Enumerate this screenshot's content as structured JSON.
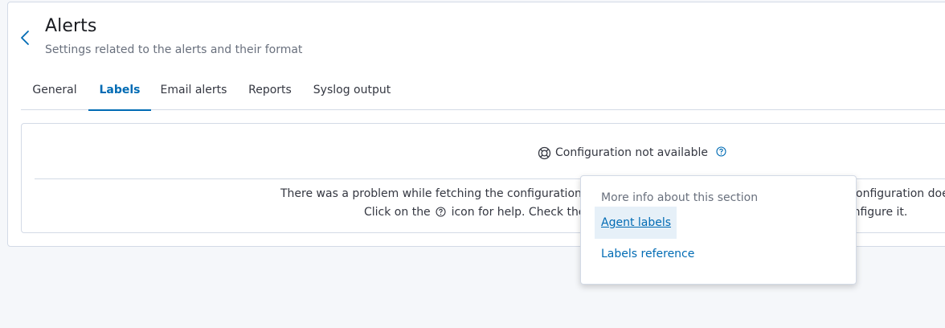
{
  "header": {
    "title": "Alerts",
    "subtitle": "Settings related to the alerts and their format"
  },
  "tabs": [
    {
      "label": "General",
      "active": false
    },
    {
      "label": "Labels",
      "active": true
    },
    {
      "label": "Email alerts",
      "active": false
    },
    {
      "label": "Reports",
      "active": false
    },
    {
      "label": "Syslog output",
      "active": false
    }
  ],
  "card": {
    "heading": "Configuration not available",
    "message_line1": "There was a problem while fetching the configuration fo",
    "message_line1_tail": "onfiguration does",
    "message_line2_pre": "Click on the",
    "message_line2_post": "icon for help. Check the",
    "message_line2_tail": "onfigure it."
  },
  "popover": {
    "title": "More info about this section",
    "links": [
      "Agent labels",
      "Labels reference"
    ]
  },
  "colors": {
    "accent": "#006bb4",
    "text": "#343741",
    "muted": "#69707d",
    "border": "#d3dae6",
    "background": "#f5f7fa"
  },
  "icons": {
    "back": "chevron-left-icon",
    "heading": "lifebuoy-icon",
    "help": "question-circle-icon"
  }
}
